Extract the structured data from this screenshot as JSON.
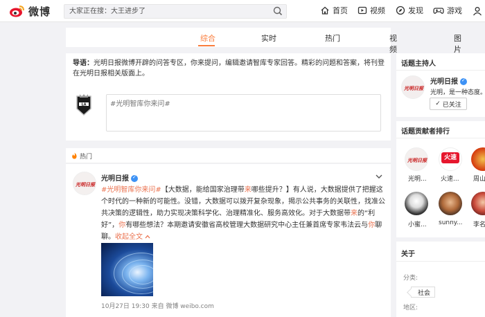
{
  "header": {
    "logo_text": "微博",
    "search_placeholder": "大家正在搜：大王进步了",
    "nav": [
      {
        "label": "首页",
        "icon": "home-icon"
      },
      {
        "label": "视频",
        "icon": "video-icon"
      },
      {
        "label": "发现",
        "icon": "compass-icon"
      },
      {
        "label": "游戏",
        "icon": "game-icon"
      }
    ]
  },
  "tabs": [
    {
      "label": "综合",
      "active": true
    },
    {
      "label": "实时",
      "active": false
    },
    {
      "label": "热门",
      "active": false
    },
    {
      "label": "视频",
      "active": false
    },
    {
      "label": "图片",
      "active": false
    }
  ],
  "intro": {
    "lead": "导语：",
    "text": "光明日报微博开辟的问答专区，你来提问，编辑邀请智库专家回答。精彩的问题和答案，将刊登在光明日报相关版面上。",
    "question_placeholder": "#光明智库你来问#"
  },
  "hot_label": "热门",
  "post": {
    "author": "光明日报",
    "hashtag": "#光明智库你来问#",
    "body_1": "【大数据，能给国家治理带",
    "body_hl1": "来",
    "body_2": "哪些提升？】有人说，大数据提供了把握这个时代的一种新的可能性。没错，大数据可以拨开复杂现象，揭示公共事务的关联性，找准公共决策的逻辑性，助力实现决策科学化、治理精准化、服务高效化。对于大数据带",
    "body_hl2": "来",
    "body_3": "的“利好”，",
    "body_hl3": "你",
    "body_4": "有哪些想法？本期邀请安徽省高校管理大数据研究中心主任兼首席专家韦法云与",
    "body_hl4": "你",
    "body_5": "聊聊。",
    "expand": "收起全文",
    "time": "10月27日 19:30",
    "source": "来自 微博 weibo.com"
  },
  "host": {
    "title": "话题主持人",
    "name": "光明日报",
    "desc": "光明，是一种态度。",
    "follow_label": "已关注"
  },
  "ranking": {
    "title": "话题贡献者排行",
    "users": [
      {
        "name": "光明..."
      },
      {
        "name": "火速..."
      },
      {
        "name": "周山..."
      },
      {
        "name": "小蜜..."
      },
      {
        "name": "sunny..."
      },
      {
        "name": "李名..."
      }
    ],
    "badge_text": "火速"
  },
  "about": {
    "title": "关于",
    "category_label": "分类:",
    "category_tag": "社会",
    "region_label": "地区:"
  },
  "colors": {
    "accent": "#fa7d3c",
    "link": "#eb7350",
    "verified": "#3d92f5"
  }
}
